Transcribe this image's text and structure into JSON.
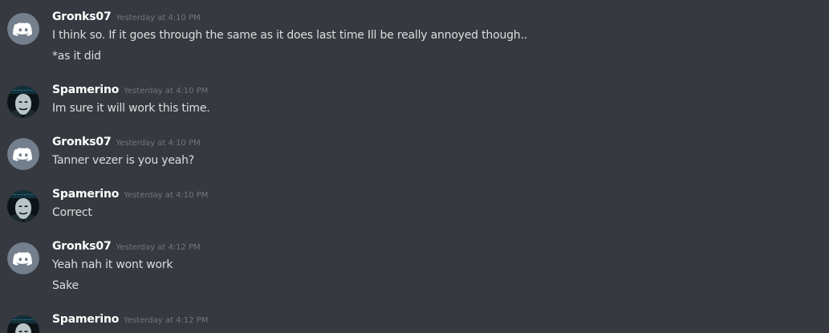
{
  "messages": [
    {
      "author": "Gronks07",
      "timestamp": "Yesterday at 4:10 PM",
      "avatar": "discord-logo-icon",
      "lines": [
        "I think so. If it goes through the same as it does last time Ill be really annoyed though..",
        "*as it did"
      ]
    },
    {
      "author": "Spamerino",
      "timestamp": "Yesterday at 4:10 PM",
      "avatar": "masked-face-icon",
      "lines": [
        "Im sure it will work this time."
      ]
    },
    {
      "author": "Gronks07",
      "timestamp": "Yesterday at 4:10 PM",
      "avatar": "discord-logo-icon",
      "lines": [
        "Tanner vezer is you yeah?"
      ]
    },
    {
      "author": "Spamerino",
      "timestamp": "Yesterday at 4:10 PM",
      "avatar": "masked-face-icon",
      "lines": [
        "Correct"
      ]
    },
    {
      "author": "Gronks07",
      "timestamp": "Yesterday at 4:12 PM",
      "avatar": "discord-logo-icon",
      "lines": [
        "Yeah nah it wont work",
        "Sake"
      ]
    },
    {
      "author": "Spamerino",
      "timestamp": "Yesterday at 4:12 PM",
      "avatar": "masked-face-icon",
      "lines": []
    }
  ],
  "colors": {
    "background": "#36393f",
    "username": "#ffffff",
    "message_text": "#dcddde",
    "timestamp": "#72767d",
    "default_avatar": "#747f8d"
  }
}
